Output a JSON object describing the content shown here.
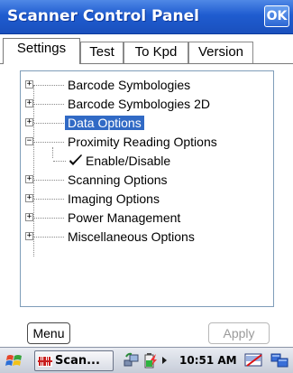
{
  "window": {
    "title": "Scanner Control Panel",
    "ok_label": "OK"
  },
  "tabs": [
    {
      "label": "Settings",
      "active": true
    },
    {
      "label": "Test",
      "active": false
    },
    {
      "label": "To Kpd",
      "active": false
    },
    {
      "label": "Version",
      "active": false
    }
  ],
  "tree": {
    "items": [
      {
        "label": "Barcode Symbologies",
        "expander": "+"
      },
      {
        "label": "Barcode Symbologies 2D",
        "expander": "+"
      },
      {
        "label": "Data Options",
        "expander": "+",
        "selected": true
      },
      {
        "label": "Proximity Reading Options",
        "expander": "−",
        "children": [
          {
            "label": "Enable/Disable",
            "checked": true
          }
        ]
      },
      {
        "label": "Scanning Options",
        "expander": "+"
      },
      {
        "label": "Imaging Options",
        "expander": "+"
      },
      {
        "label": "Power Management",
        "expander": "+"
      },
      {
        "label": "Miscellaneous Options",
        "expander": "+"
      }
    ]
  },
  "buttons": {
    "menu_label": "Menu",
    "apply_label": "Apply"
  },
  "taskbar": {
    "task_label": "Scan...",
    "clock": "10:51 AM",
    "icons": [
      "start-flag-icon",
      "scanner-app-icon",
      "network-icon",
      "battery-icon",
      "arrow-icon",
      "keyboard-icon",
      "windows-icon"
    ]
  },
  "colors": {
    "title_bar": "#1f5cd0",
    "selection": "#316ac5"
  }
}
